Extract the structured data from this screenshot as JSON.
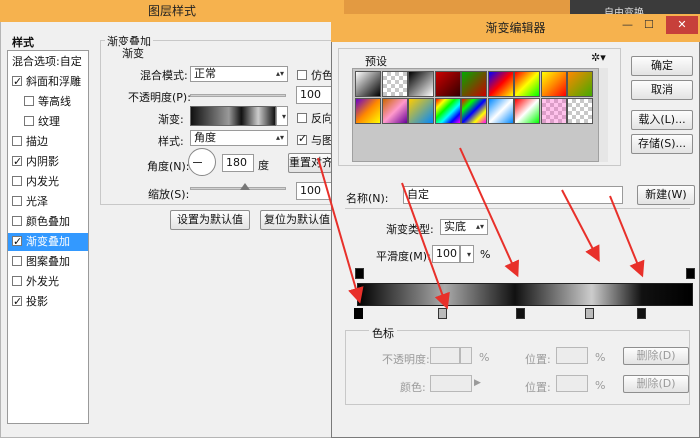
{
  "layer_style": {
    "title": "图层样式",
    "styles_header": "样式",
    "styles": [
      {
        "label": "混合选项:自定",
        "checkbox": false,
        "checked": false,
        "selected": false
      },
      {
        "label": "斜面和浮雕",
        "checkbox": true,
        "checked": true,
        "selected": false
      },
      {
        "label": "等高线",
        "checkbox": true,
        "checked": false,
        "selected": false
      },
      {
        "label": "纹理",
        "checkbox": true,
        "checked": false,
        "selected": false
      },
      {
        "label": "描边",
        "checkbox": true,
        "checked": false,
        "selected": false
      },
      {
        "label": "内阴影",
        "checkbox": true,
        "checked": true,
        "selected": false
      },
      {
        "label": "内发光",
        "checkbox": true,
        "checked": false,
        "selected": false
      },
      {
        "label": "光泽",
        "checkbox": true,
        "checked": false,
        "selected": false
      },
      {
        "label": "颜色叠加",
        "checkbox": true,
        "checked": false,
        "selected": false
      },
      {
        "label": "渐变叠加",
        "checkbox": true,
        "checked": true,
        "selected": true
      },
      {
        "label": "图案叠加",
        "checkbox": true,
        "checked": false,
        "selected": false
      },
      {
        "label": "外发光",
        "checkbox": true,
        "checked": false,
        "selected": false
      },
      {
        "label": "投影",
        "checkbox": true,
        "checked": true,
        "selected": false
      }
    ],
    "section_title": "渐变叠加",
    "group_title": "渐变",
    "blend_mode_label": "混合模式:",
    "blend_mode_value": "正常",
    "dither_label": "仿色",
    "opacity_label": "不透明度(P):",
    "opacity_value": "100",
    "gradient_label": "渐变:",
    "reverse_label": "反向",
    "style_label": "样式:",
    "style_value": "角度",
    "align_label": "与图",
    "angle_label": "角度(N):",
    "angle_value": "180",
    "degree_unit": "度",
    "reset_align_label": "重置对齐",
    "scale_label": "缩放(S):",
    "scale_value": "100",
    "set_default_label": "设置为默认值",
    "reset_default_label": "复位为默认值"
  },
  "background": {
    "menu_item": "自由变换"
  },
  "gradient_editor": {
    "title": "渐变编辑器",
    "presets_label": "预设",
    "gear_icon": "gear-icon",
    "ok_label": "确定",
    "cancel_label": "取消",
    "load_label": "载入(L)...",
    "save_label": "存储(S)...",
    "name_label": "名称(N):",
    "name_value": "自定",
    "new_label": "新建(W)",
    "gradient_type_label": "渐变类型:",
    "gradient_type_value": "实底",
    "smoothness_label": "平滑度(M):",
    "smoothness_value": "100",
    "percent": "%",
    "stops_group_label": "色标",
    "stop_opacity_label": "不透明度:",
    "location_label": "位置:",
    "delete_label": "删除(D)",
    "color_label": "颜色:",
    "accent_red": "#e8302a"
  }
}
